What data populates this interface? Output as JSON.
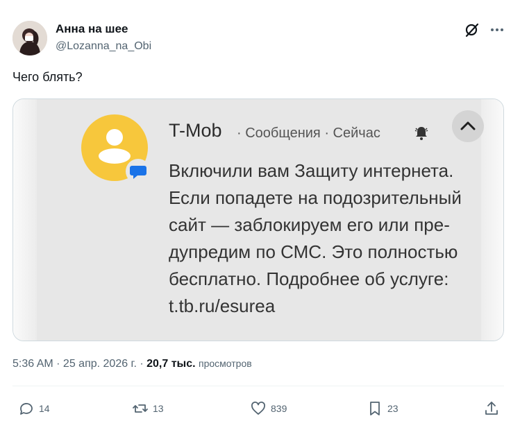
{
  "author": {
    "name": "Анна на шее",
    "handle": "@Lozanna_na_Obi"
  },
  "tweet": {
    "text": "Чего блять?"
  },
  "notification": {
    "app_name": "T-Mob",
    "meta": "· Сообщения · Сейчас",
    "body_lines": [
      "Включили вам Защиту интернета.",
      "Если попадете на подозрительный",
      "сайт — заблокируем его или пре-",
      "дупредим по СМС. Это полностью",
      "бесплатно. Подробнее об услуге:",
      "t.tb.ru/esurea"
    ],
    "icons": [
      "person-avatar-icon",
      "message-bubble-icon",
      "bell-icon",
      "chevron-up-icon"
    ],
    "colors": {
      "avatar": "#f7c73c",
      "badge": "#1a73e8"
    }
  },
  "timestamp": {
    "time_date": "5:36 AM · 25 апр. 2026 г. ·",
    "views_count": "20,7 тыс.",
    "views_label": "просмотров"
  },
  "actions": {
    "reply_count": "14",
    "retweet_count": "13",
    "like_count": "839",
    "bookmark_count": "23"
  },
  "icons": [
    "grok-icon",
    "more-icon",
    "reply-icon",
    "retweet-icon",
    "like-icon",
    "bookmark-icon",
    "share-icon"
  ]
}
